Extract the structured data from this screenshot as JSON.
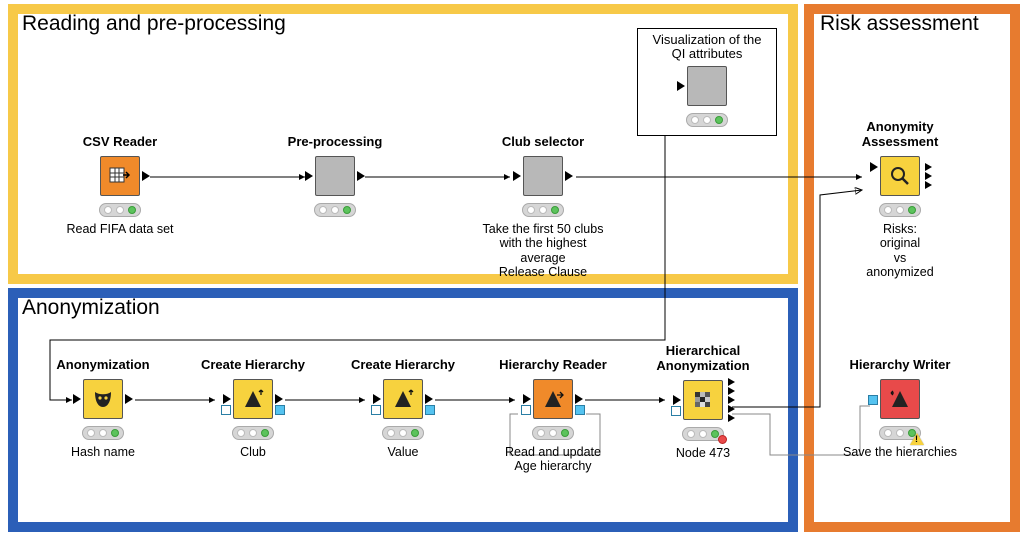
{
  "groups": {
    "preprocessing": {
      "title": "Reading and pre-processing"
    },
    "anonymization": {
      "title": "Anonymization"
    },
    "risk": {
      "title": "Risk assessment"
    }
  },
  "inner_box": {
    "title": "Visualization of\nthe QI attributes"
  },
  "nodes": {
    "csv": {
      "title": "CSV Reader",
      "caption": "Read FIFA data set"
    },
    "prep": {
      "title": "Pre-processing",
      "caption": ""
    },
    "club": {
      "title": "Club selector",
      "caption": "Take the first 50 clubs\nwith the highest average\nRelease Clause"
    },
    "viz": {
      "title": "",
      "caption": ""
    },
    "anon": {
      "title": "Anonymization",
      "caption": "Hash name"
    },
    "h1": {
      "title": "Create Hierarchy",
      "caption": "Club"
    },
    "h2": {
      "title": "Create Hierarchy",
      "caption": "Value"
    },
    "hr": {
      "title": "Hierarchy Reader",
      "caption": "Read and update\nAge hierarchy"
    },
    "ha": {
      "title": "Hierarchical\nAnonymization",
      "caption": "Node 473"
    },
    "aa": {
      "title": "Anonymity\nAssessment",
      "caption": "Risks:\noriginal\nvs\nanonymized"
    },
    "hw": {
      "title": "Hierarchy Writer",
      "caption": "Save the hierarchies"
    }
  },
  "colors": {
    "yellow_border": "#f7c948",
    "blue_border": "#2b5fb8",
    "orange_border": "#e77b2f",
    "node_orange": "#f08a2a",
    "node_gray": "#b8b8b8",
    "node_yellow": "#f7d23e",
    "node_red": "#e84a4a"
  }
}
